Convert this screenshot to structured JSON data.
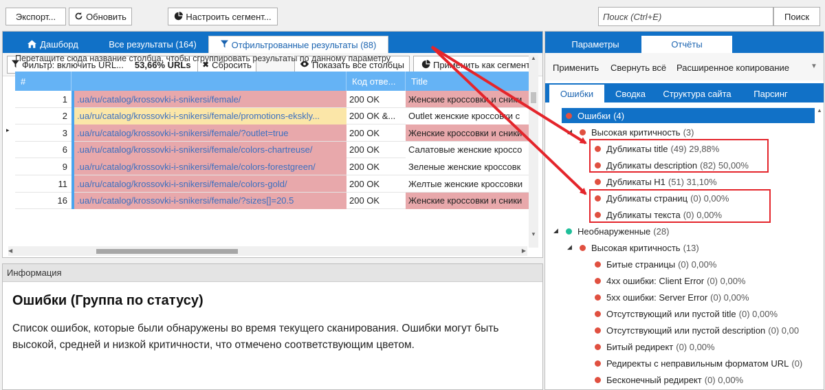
{
  "toolbar": {
    "export_label": "Экспорт...",
    "refresh_label": "Обновить",
    "segment_label": "Настроить сегмент...",
    "search_placeholder": "Поиск (Ctrl+E)",
    "search_button_label": "Поиск"
  },
  "left_tabs": [
    {
      "label": "Дашборд",
      "icon": "home-icon"
    },
    {
      "label": "Все результаты (164)"
    },
    {
      "label": "Отфильтрованные результаты (88)",
      "icon": "filter-icon",
      "active": true
    }
  ],
  "filterbar": {
    "filter_label": "Фильтр: включить URL...",
    "filter_percent": "53,66% URLs",
    "reset_label": "Сбросить",
    "show_columns_label": "Показать все столбцы",
    "apply_segment_label": "Применить как сегмент"
  },
  "grid": {
    "drop_hint": "Перетащите сюда название столбца, чтобы сгруппировать результаты по данному параметру",
    "columns": [
      "#",
      "",
      "Код отве...",
      "Title"
    ],
    "rows": [
      {
        "num": "1",
        "url": ".ua/ru/catalog/krossovki-i-snikersi/female/",
        "code": "200 OK",
        "title": "Женские кроссовки и сники",
        "url_bg": "#e8a8ab",
        "title_bg": "#e8a8ab",
        "current": true
      },
      {
        "num": "2",
        "url": ".ua/ru/catalog/krossovki-i-snikersi/female/promotions-ekskly...",
        "code": "200 OK &...",
        "title": "Outlet женские кроссовки с",
        "url_bg": "#fbe6a8",
        "title_bg": "#ffffff"
      },
      {
        "num": "3",
        "url": ".ua/ru/catalog/krossovki-i-snikersi/female/?outlet=true",
        "code": "200 OK",
        "title": "Женские кроссовки и сники",
        "url_bg": "#e8a8ab",
        "title_bg": "#e8a8ab"
      },
      {
        "num": "6",
        "url": ".ua/ru/catalog/krossovki-i-snikersi/female/colors-chartreuse/",
        "code": "200 OK",
        "title": "Салатовые женские кроссо",
        "url_bg": "#e8a8ab",
        "title_bg": "#ffffff"
      },
      {
        "num": "9",
        "url": ".ua/ru/catalog/krossovki-i-snikersi/female/colors-forestgreen/",
        "code": "200 OK",
        "title": "Зеленые женские кроссовк",
        "url_bg": "#e8a8ab",
        "title_bg": "#ffffff"
      },
      {
        "num": "11",
        "url": ".ua/ru/catalog/krossovki-i-snikersi/female/colors-gold/",
        "code": "200 OK",
        "title": "Желтые женские кроссовки",
        "url_bg": "#e8a8ab",
        "title_bg": "#ffffff"
      },
      {
        "num": "16",
        "url": ".ua/ru/catalog/krossovki-i-snikersi/female/?sizes[]=20.5",
        "code": "200 OK",
        "title": "Женские кроссовки и сники",
        "url_bg": "#e8a8ab",
        "title_bg": "#e8a8ab"
      }
    ]
  },
  "info": {
    "header": "Информация",
    "title": "Ошибки (Группа по статусу)",
    "description": "Список ошибок, которые были обнаружены во время текущего сканирования. Ошибки могут быть высокой, средней и низкой критичности, что отмечено соответствующим цветом."
  },
  "right_tabs": [
    {
      "label": "Параметры"
    },
    {
      "label": "Отчёты",
      "active": true
    }
  ],
  "right_toolbar": {
    "apply_label": "Применить",
    "collapse_label": "Свернуть всё",
    "advanced_copy_label": "Расширенное копирование"
  },
  "sub_tabs": [
    {
      "label": "Ошибки",
      "active": true
    },
    {
      "label": "Сводка"
    },
    {
      "label": "Структура сайта"
    },
    {
      "label": "Парсинг"
    }
  ],
  "tree": [
    {
      "label": "Ошибки",
      "count": "(4)",
      "level": 0,
      "dot": "#e05040",
      "selected": true
    },
    {
      "label": "Высокая критичность",
      "count": "(3)",
      "level": 1,
      "dot": "#e05040",
      "expander": true
    },
    {
      "label": "Дубликаты title",
      "count": "(49) 29,88%",
      "level": 2,
      "dot": "#e05040"
    },
    {
      "label": "Дубликаты description",
      "count": "(82) 50,00%",
      "level": 2,
      "dot": "#e05040"
    },
    {
      "label": "Дубликаты H1",
      "count": "(51) 31,10%",
      "level": 2,
      "dot": "#e05040"
    },
    {
      "label": "Дубликаты страниц",
      "count": "(0) 0,00%",
      "level": 2,
      "dot": "#e05040"
    },
    {
      "label": "Дубликаты текста",
      "count": "(0) 0,00%",
      "level": 2,
      "dot": "#e05040"
    },
    {
      "label": "Необнаруженные",
      "count": "(28)",
      "level": 0,
      "dot": "#1fbf9a",
      "expander": true
    },
    {
      "label": "Высокая критичность",
      "count": "(13)",
      "level": 1,
      "dot": "#e05040",
      "expander": true
    },
    {
      "label": "Битые страницы",
      "count": "(0) 0,00%",
      "level": 2,
      "dot": "#e05040"
    },
    {
      "label": "4xx ошибки: Client Error",
      "count": "(0) 0,00%",
      "level": 2,
      "dot": "#e05040"
    },
    {
      "label": "5xx ошибки: Server Error",
      "count": "(0) 0,00%",
      "level": 2,
      "dot": "#e05040"
    },
    {
      "label": "Отсутствующий или пустой title",
      "count": "(0) 0,00%",
      "level": 2,
      "dot": "#e05040"
    },
    {
      "label": "Отсутствующий или пустой description",
      "count": "(0) 0,00",
      "level": 2,
      "dot": "#e05040"
    },
    {
      "label": "Битый редирект",
      "count": "(0) 0,00%",
      "level": 2,
      "dot": "#e05040"
    },
    {
      "label": "Редиректы с неправильным форматом URL",
      "count": "(0)",
      "level": 2,
      "dot": "#e05040"
    },
    {
      "label": "Бесконечный редирект",
      "count": "(0) 0,00%",
      "level": 2,
      "dot": "#e05040"
    }
  ],
  "colors": {
    "accent": "#1171c7",
    "header_blue": "#65b3f5",
    "annotation_red": "#e4252b",
    "error_red": "#e05040",
    "teal": "#1fbf9a"
  }
}
